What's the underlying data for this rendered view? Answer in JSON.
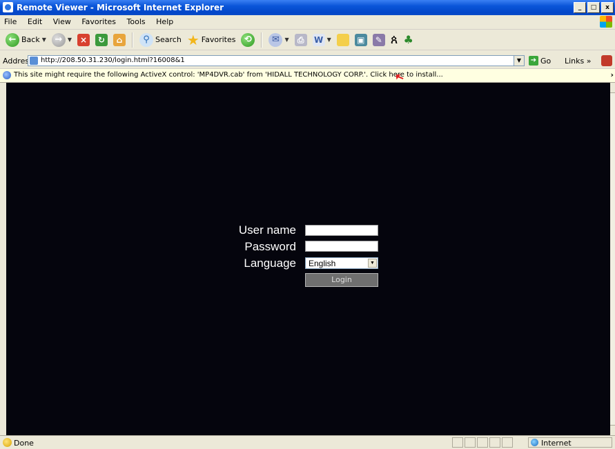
{
  "window": {
    "title": "Remote Viewer - Microsoft Internet Explorer",
    "controls": [
      "minimize",
      "maximize",
      "close"
    ]
  },
  "menubar": {
    "items": [
      "File",
      "Edit",
      "View",
      "Favorites",
      "Tools",
      "Help"
    ]
  },
  "toolbar": {
    "back_label": "Back",
    "search_label": "Search",
    "favorites_label": "Favorites"
  },
  "address": {
    "label": "Address",
    "url": "http://208.50.31.230/login.html?16008&1",
    "go_label": "Go",
    "links_label": "Links"
  },
  "infobar": {
    "message": "This site might require the following ActiveX control: 'MP4DVR.cab' from 'HIDALL TECHNOLOGY CORP.'. Click here to install..."
  },
  "login": {
    "username_label": "User name",
    "password_label": "Password",
    "language_label": "Language",
    "language_value": "English",
    "username_value": "",
    "password_value": "",
    "login_button": "Login"
  },
  "status": {
    "text": "Done",
    "zone": "Internet"
  }
}
